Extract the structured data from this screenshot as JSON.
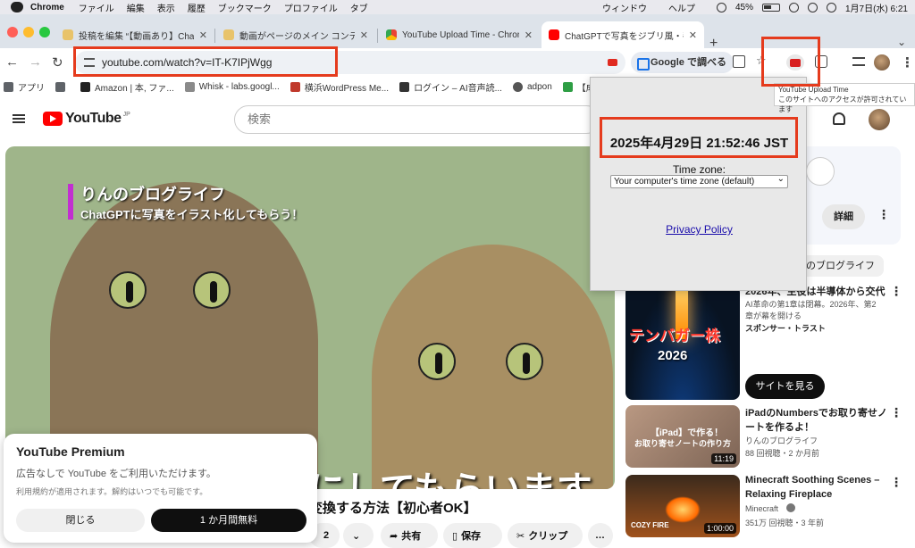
{
  "menubar": {
    "app_name": "Chrome",
    "items": [
      "ファイル",
      "編集",
      "表示",
      "履歴",
      "ブックマーク",
      "プロファイル",
      "タブ",
      "ウィンドウ",
      "ヘルプ"
    ],
    "battery": "45%",
    "datetime": "1月7日(水) 6:21"
  },
  "tabs": [
    {
      "title": "投稿を編集 “【動画あり】ChatGPTで",
      "favicon_color": "#e8c36a"
    },
    {
      "title": "動画がページのメイン コンテンツで",
      "favicon_color": "#e8c36a"
    },
    {
      "title": "YouTube Upload Time - Chrome",
      "favicon_color": "#4285f4"
    },
    {
      "title": "ChatGPTで写真をジブリ風・手書き",
      "favicon_color": "#ff0000"
    }
  ],
  "toolbar": {
    "url": "youtube.com/watch?v=IT-K7IPjWgg",
    "google_label": "Google で調べる"
  },
  "bookmarks": [
    {
      "label": "アプリ",
      "color": "#5f6368"
    },
    {
      "label": "",
      "color": "#5f6368"
    },
    {
      "label": "Amazon | 本, ファ...",
      "color": "#222222"
    },
    {
      "label": "Whisk - labs.googl...",
      "color": "#8a8a8a"
    },
    {
      "label": "横浜WordPress Me...",
      "color": "#c0392b"
    },
    {
      "label": "ログイン – AI音声読...",
      "color": "#333333"
    },
    {
      "label": "adpon",
      "color": "#555555"
    },
    {
      "label": "【成",
      "color": "#2e9e44"
    }
  ],
  "youtube": {
    "logo": "YouTube",
    "region": "JP",
    "search_placeholder": "検索",
    "video": {
      "overlay_title": "りんのブログライフ",
      "overlay_subtitle": "ChatGPTに写真をイラスト化してもらう！",
      "big_caption": "にしてもらいます",
      "title_fragment": "変換する方法【初心者OK】"
    },
    "actions": {
      "likes": "2",
      "share": "共有",
      "save": "保存",
      "clip": "クリップ",
      "more": "…"
    },
    "premium": {
      "title": "YouTube Premium",
      "desc": "広告なしで YouTube をご利用いただけます。",
      "terms": "利用規約が適用されます。解約はいつでも可能です。",
      "close": "閉じる",
      "trial": "1 か月間無料"
    },
    "sidebar": {
      "details_button": "詳細",
      "channel_chip": "りんのブログライフ",
      "ad": {
        "thumb_line1": "テンバガー株",
        "thumb_line2": "2026",
        "title": "2026年、主役は半導体から交代",
        "desc_line1": "AI革命の第1章は閉幕。2026年、第2",
        "desc_line2": "章が幕を開ける",
        "sponsor": "スポンサー・トラスト",
        "cta": "サイトを見る"
      },
      "videos": [
        {
          "title_line1": "iPadのNumbersでお取り寄せノ",
          "title_line2": "ートを作るよ！",
          "channel": "りんのブログライフ",
          "meta": "88 回視聴・2 か月前",
          "duration": "11:19",
          "thumb_line1": "【iPad】で作る！",
          "thumb_line2": "お取り寄せノートの作り方"
        },
        {
          "title_line1": "Minecraft Soothing Scenes –",
          "title_line2": "Relaxing Fireplace",
          "channel": "Minecraft",
          "meta": "351万 回視聴・3 年前",
          "duration": "1:00:00",
          "thumb_line1": "COZY FIRE"
        }
      ]
    }
  },
  "popup": {
    "upload_time": "2025年4月29日 21:52:46 JST",
    "timezone_label": "Time zone:",
    "timezone_value": "Your computer's time zone (default)",
    "privacy": "Privacy Policy"
  },
  "tooltip": {
    "line1": "YouTube Upload Time",
    "line2": "このサイトへのアクセスが許可されています"
  },
  "colors": {
    "annotation": "#e53b1d",
    "youtube_red": "#ff0000",
    "link": "#1a0dab"
  }
}
